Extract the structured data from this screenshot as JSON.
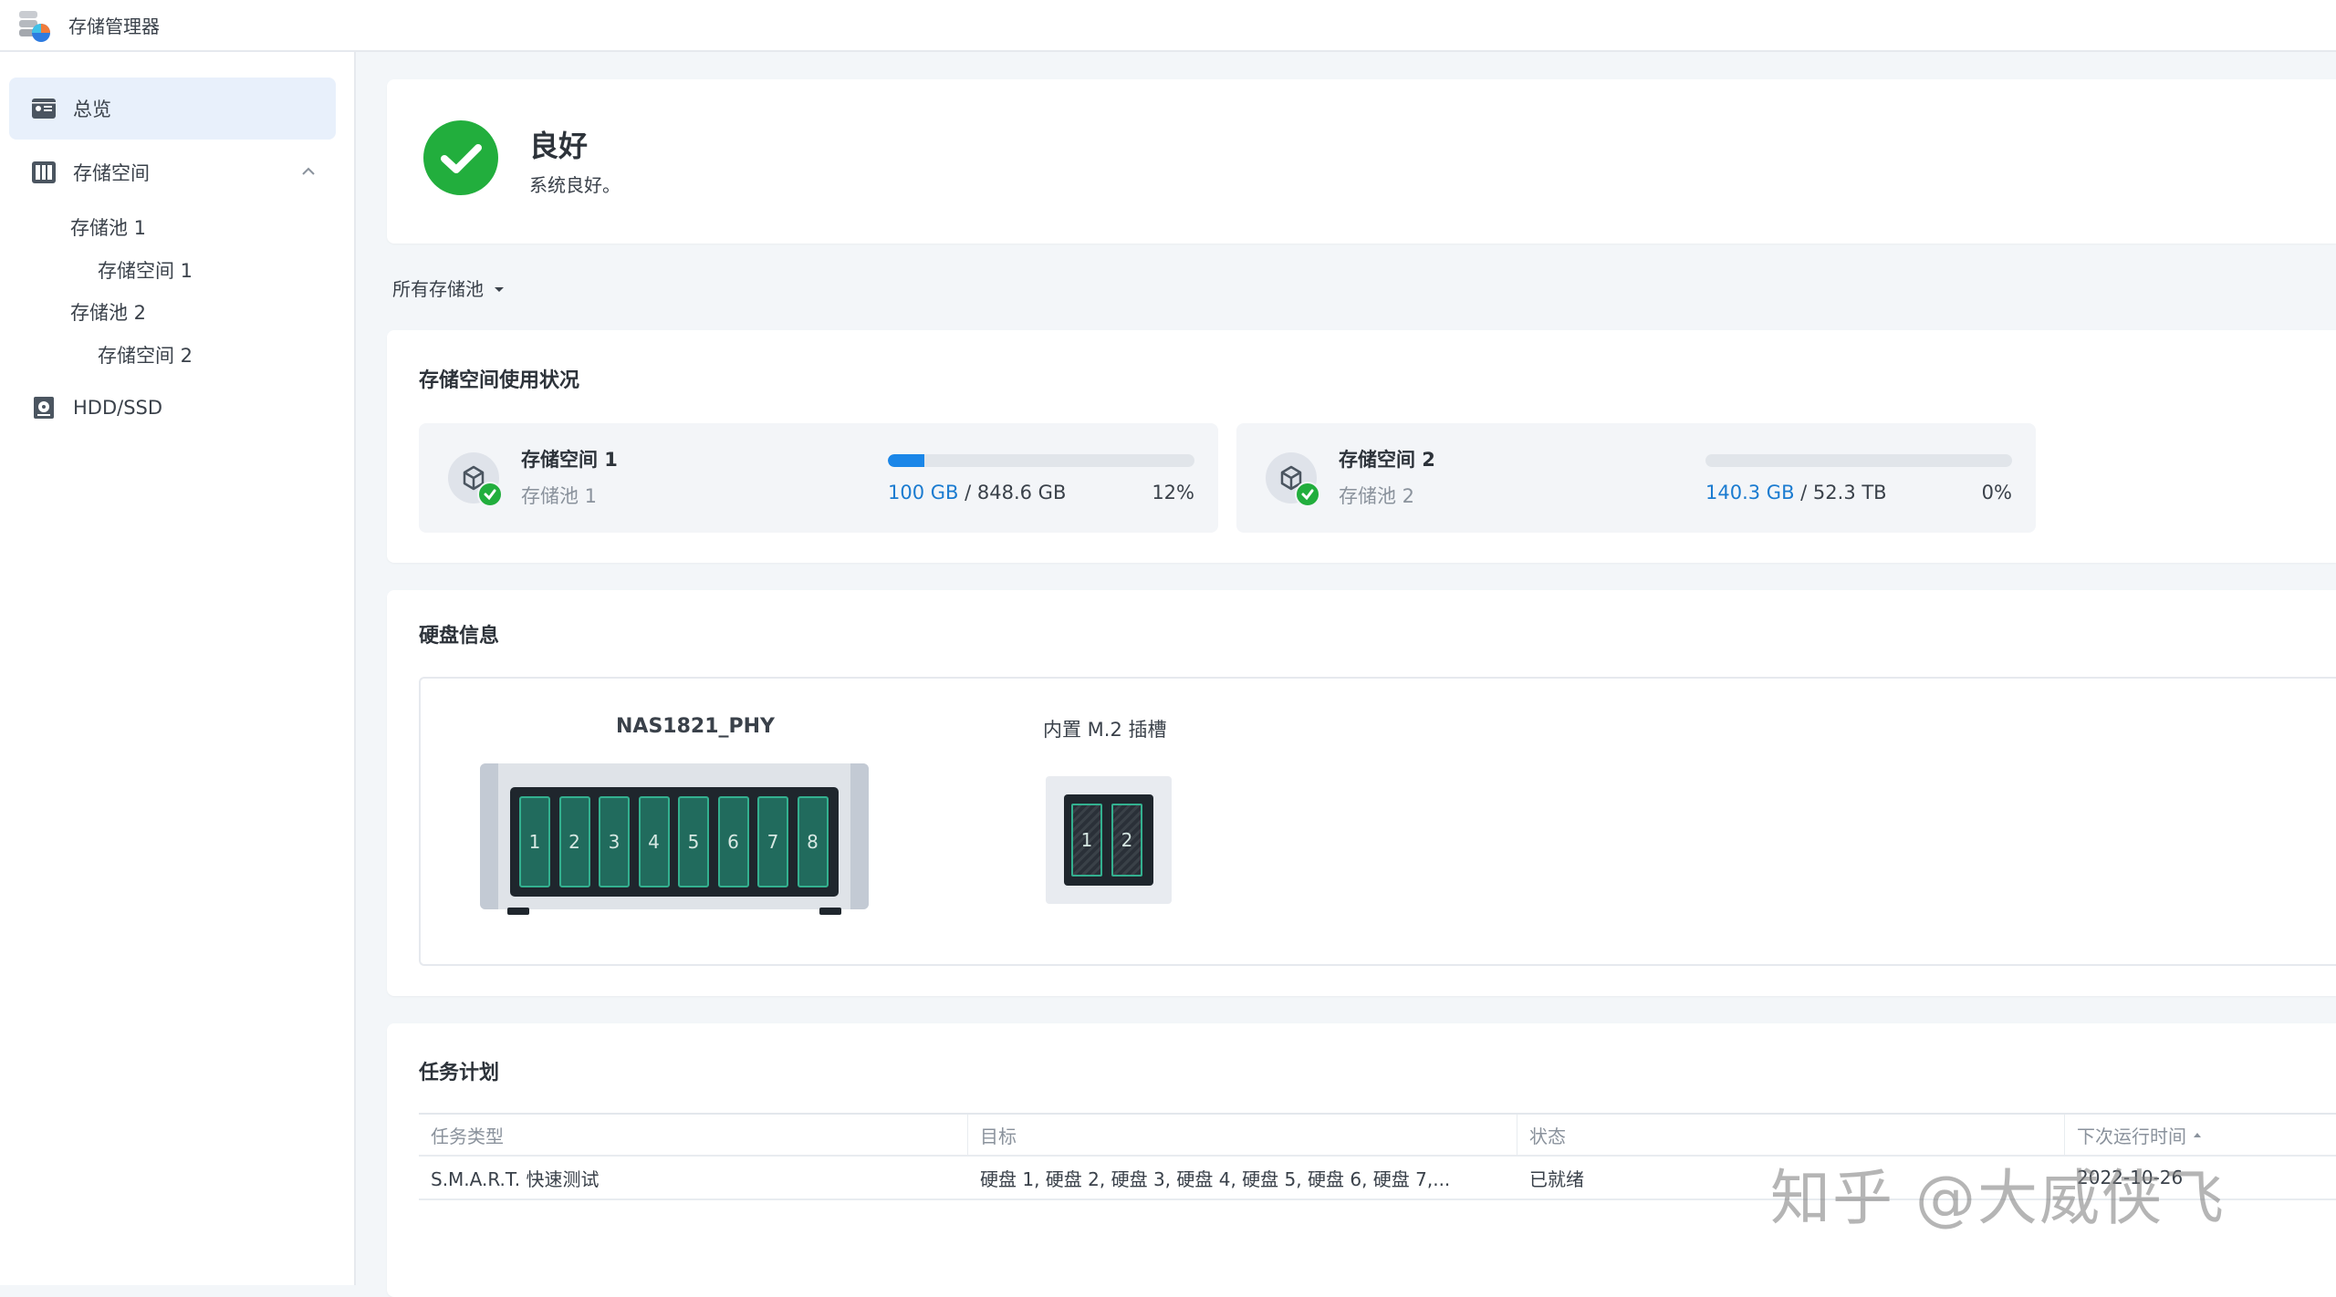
{
  "app": {
    "title": "存储管理器",
    "icon": "storage-manager-icon"
  },
  "sidebar": {
    "items": [
      {
        "label": "总览",
        "icon": "overview-card-icon",
        "active": true
      },
      {
        "label": "存储空间",
        "icon": "storage-columns-icon",
        "expanded": true
      },
      {
        "label": "HDD/SSD",
        "icon": "hard-disk-icon"
      }
    ],
    "sub_items": [
      {
        "label": "存储池 1",
        "level": 1
      },
      {
        "label": "存储空间 1",
        "level": 2
      },
      {
        "label": "存储池 2",
        "level": 1
      },
      {
        "label": "存储空间 2",
        "level": 2
      }
    ]
  },
  "status": {
    "title": "良好",
    "description": "系统良好。",
    "color": "#22ae3d"
  },
  "pool_filter": {
    "label": "所有存储池"
  },
  "usage": {
    "title": "存储空间使用状况",
    "volumes": [
      {
        "name": "存储空间 1",
        "pool": "存储池 1",
        "used": "100 GB",
        "total": "/ 848.6 GB",
        "percent_label": "12%",
        "percent": 12
      },
      {
        "name": "存储空间 2",
        "pool": "存储池 2",
        "used": "140.3 GB",
        "total": "/ 52.3 TB",
        "percent_label": "0%",
        "percent": 0
      }
    ],
    "accent": "#1a86e8"
  },
  "disks": {
    "title": "硬盘信息",
    "nas_name": "NAS1821_PHY",
    "bays": [
      "1",
      "2",
      "3",
      "4",
      "5",
      "6",
      "7",
      "8"
    ],
    "m2_label": "内置 M.2 插槽",
    "m2_slots": [
      "1",
      "2"
    ]
  },
  "tasks": {
    "title": "任务计划",
    "columns": [
      "任务类型",
      "目标",
      "状态",
      "下次运行时间"
    ],
    "rows": [
      {
        "type": "S.M.A.R.T. 快速测试",
        "target": "硬盘 1, 硬盘 2, 硬盘 3, 硬盘 4, 硬盘 5, 硬盘 6, 硬盘 7,...",
        "status": "已就绪",
        "next_run": "2022-10-26"
      }
    ]
  },
  "watermark": "知乎 @大威侠飞"
}
